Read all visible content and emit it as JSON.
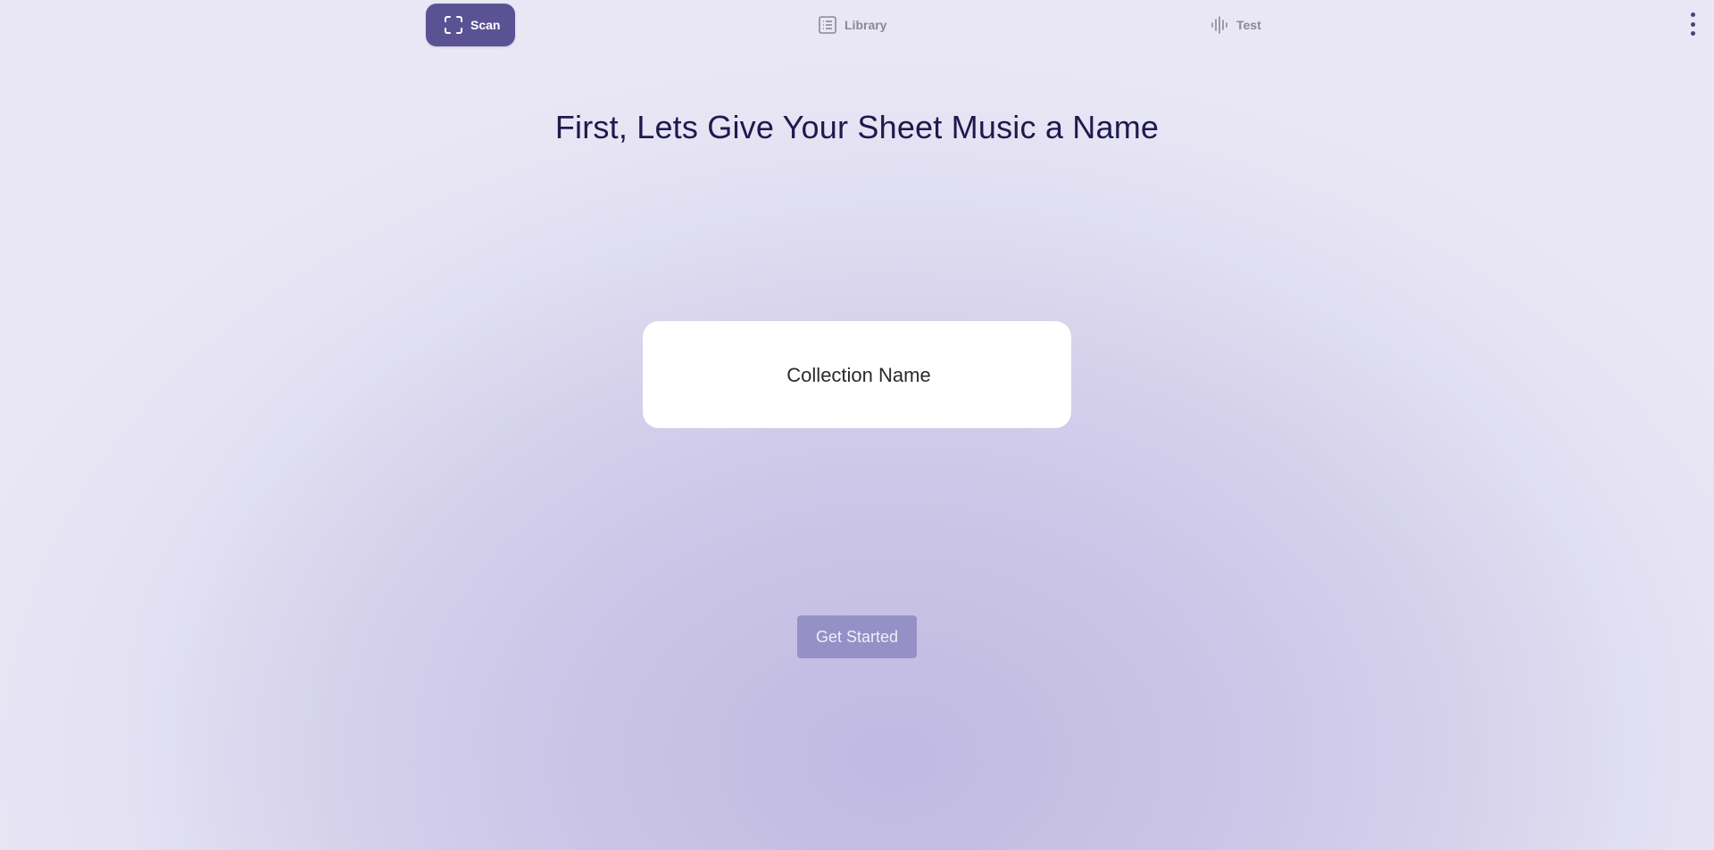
{
  "nav": {
    "items": [
      {
        "label": "Scan",
        "icon": "scan-frame-icon",
        "active": true
      },
      {
        "label": "Library",
        "icon": "list-icon",
        "active": false
      },
      {
        "label": "Test",
        "icon": "audio-wave-icon",
        "active": false
      }
    ],
    "menu_icon": "more-vertical-icon"
  },
  "main": {
    "title": "First, Lets Give Your Sheet Music a Name",
    "collection_input": {
      "placeholder": "Collection Name",
      "value": ""
    },
    "cta_label": "Get Started"
  },
  "colors": {
    "accent": "#5b5294",
    "title": "#1e1a4d",
    "button_disabled": "#9590c6"
  }
}
